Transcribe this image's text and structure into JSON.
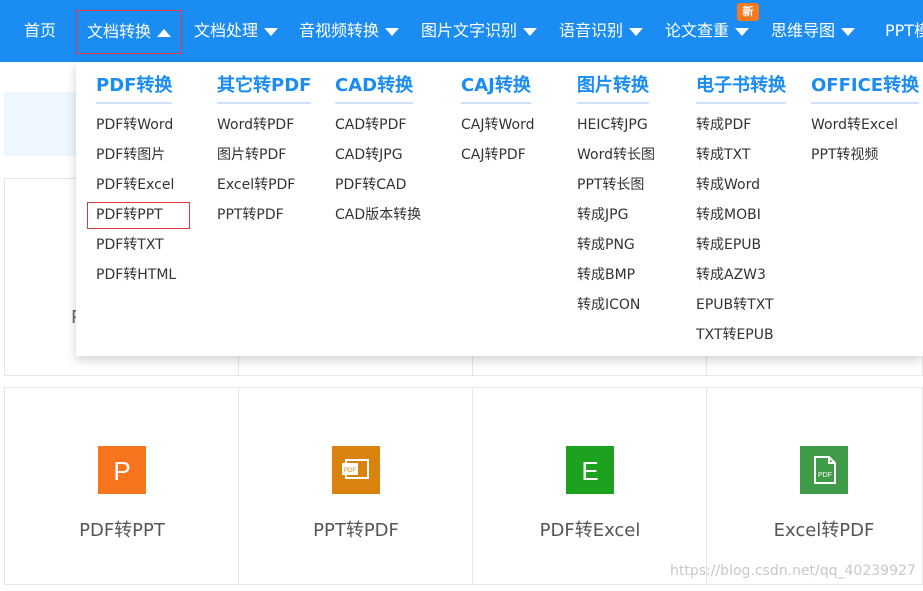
{
  "nav": {
    "items": [
      {
        "label": "首页",
        "caret": false
      },
      {
        "label": "文档转换",
        "caret": "up",
        "active": true
      },
      {
        "label": "文档处理",
        "caret": "down"
      },
      {
        "label": "音视频转换",
        "caret": "down"
      },
      {
        "label": "图片文字识别",
        "caret": "down"
      },
      {
        "label": "语音识别",
        "caret": "down"
      },
      {
        "label": "论文查重",
        "caret": "down"
      },
      {
        "label": "思维导图",
        "caret": "down"
      },
      {
        "label": "PPT模",
        "caret": false
      }
    ],
    "badge": "新"
  },
  "dropdown": {
    "columns": [
      {
        "title": "PDF转换",
        "items": [
          "PDF转Word",
          "PDF转图片",
          "PDF转Excel",
          "PDF转PPT",
          "PDF转TXT",
          "PDF转HTML"
        ]
      },
      {
        "title": "其它转PDF",
        "items": [
          "Word转PDF",
          "图片转PDF",
          "Excel转PDF",
          "PPT转PDF"
        ]
      },
      {
        "title": "CAD转换",
        "items": [
          "CAD转PDF",
          "CAD转JPG",
          "PDF转CAD",
          "CAD版本转换"
        ]
      },
      {
        "title": "CAJ转换",
        "items": [
          "CAJ转Word",
          "CAJ转PDF"
        ]
      },
      {
        "title": "图片转换",
        "items": [
          "HEIC转JPG",
          "Word转长图",
          "PPT转长图",
          "转成JPG",
          "转成PNG",
          "转成BMP",
          "转成ICON"
        ]
      },
      {
        "title": "电子书转换",
        "items": [
          "转成PDF",
          "转成TXT",
          "转成Word",
          "转成MOBI",
          "转成EPUB",
          "转成AZW3",
          "EPUB转TXT",
          "TXT转EPUB"
        ]
      },
      {
        "title": "OFFICE转换",
        "items": [
          "Word转Excel",
          "PPT转视频"
        ]
      }
    ]
  },
  "background": {
    "partial_letter": "P"
  },
  "tools": [
    {
      "label": "PDF转PPT",
      "icon": "ppt-letter-icon",
      "icon_text": "P",
      "color": "#f7741f"
    },
    {
      "label": "PPT转PDF",
      "icon": "ppt-to-pdf-icon",
      "icon_text": "PDF",
      "color": "#d9820d"
    },
    {
      "label": "PDF转Excel",
      "icon": "excel-letter-icon",
      "icon_text": "E",
      "color": "#1da21f"
    },
    {
      "label": "Excel转PDF",
      "icon": "pdf-file-icon",
      "icon_text": "PDF",
      "color": "#3f9b47"
    }
  ],
  "watermark": "https://blog.csdn.net/qq_40239927",
  "colors": {
    "nav_bg": "#1a8cf2",
    "accent": "#1a8cf2",
    "highlight_border": "#e2383f",
    "badge": "#f47b20"
  }
}
